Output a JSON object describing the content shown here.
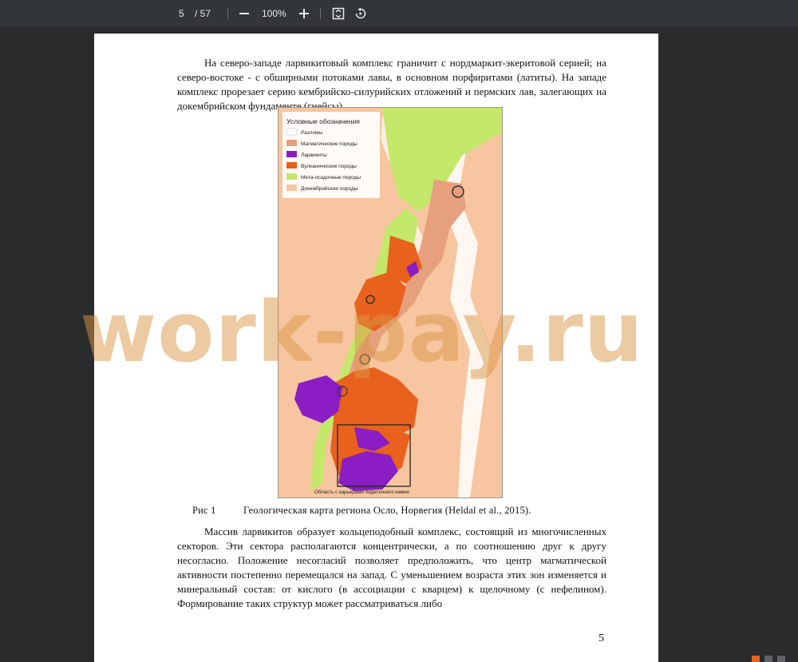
{
  "toolbar": {
    "page_current": "5",
    "page_total": "/ 57",
    "zoom": "100%",
    "zoom_out_icon": "minus-icon",
    "zoom_in_icon": "plus-icon",
    "fit_icon": "fit-page-icon",
    "rotate_icon": "rotate-icon"
  },
  "document": {
    "paragraph1": "На северо-западе ларвикитовый комплекс граничит с нордмаркит-экеритовой серией; на северо-востоке - с обширными потоками лавы, в основном порфиритами (латиты). На западе комплекс прорезает серию кембрийско-силурийских отложений и пермских лав, залегающих на докембрийском фундаменте (гнейсы).",
    "figure": {
      "legend_title": "Условные обозначения",
      "legend_items": [
        {
          "label": "Разломы",
          "color": "#ffffff"
        },
        {
          "label": "Магматические породы",
          "color": "#e7a07e"
        },
        {
          "label": "Ларвикиты",
          "color": "#8a1dc4"
        },
        {
          "label": "Вулканические породы",
          "color": "#e8611d"
        },
        {
          "label": "Мета-осадочные породы",
          "color": "#c4e86a"
        },
        {
          "label": "Докембрийские породы",
          "color": "#f7c59f"
        }
      ],
      "inset_label": "Область с карьерами поделочного камня",
      "caption_label": "Рис 1",
      "caption_text": "Геологическая карта региона Осло, Норвегия (Heldal et al., 2015)."
    },
    "paragraph2": "Массив ларвикитов образует кольцеподобный комплекс, состоящий из многочисленных секторов. Эти сектора располагаются концентрически, а по соотношению друг к другу несогласно. Положение несогласий позволяет предположить, что центр магматической активности постепенно перемещался на запад. С уменьшением возраста этих зон изменяется и минеральный состав: от кислого (в ассоциации с кварцем) к щелочному (с нефелином). Формирование таких структур может рассматриваться либо",
    "page_number": "5"
  },
  "watermark": "work-pay.ru"
}
